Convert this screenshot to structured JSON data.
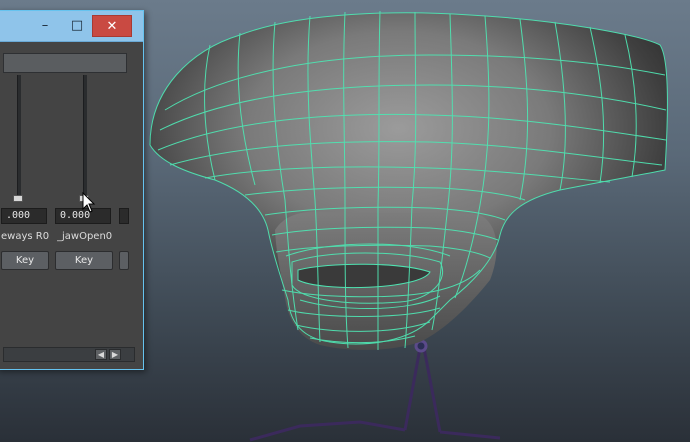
{
  "window": {
    "title_buttons": {
      "minimize": "–",
      "maximize": "□",
      "close": "✕"
    }
  },
  "blendshape": {
    "columns": [
      {
        "value": ".000",
        "name": "eways R0",
        "key_label": "Key",
        "slider_level": 0
      },
      {
        "value": "0.000",
        "name": "_jawOpen0",
        "key_label": "Key",
        "slider_level": 0
      }
    ],
    "scroll_left": "◀",
    "scroll_right": "▶"
  },
  "viewport": {
    "wireframe_color": "#4fe3b1",
    "mesh_color": "#8a8a8a",
    "bone_color": "#3b2a5c"
  }
}
